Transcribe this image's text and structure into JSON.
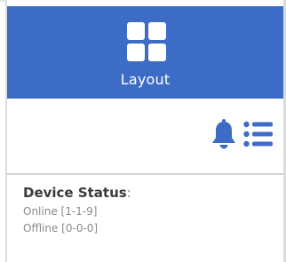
{
  "layout_tile": {
    "label": "Layout",
    "icon": "grid-layout-icon",
    "background_color": "#3d6cc6"
  },
  "toolbar": {
    "notifications_icon": "bell-icon",
    "list_icon": "list-icon",
    "icon_color": "#3d6cc6"
  },
  "device_status": {
    "heading": "Device Status",
    "separator": ":",
    "online": "Online [1-1-9]",
    "offline": "Offline [0-0-0]"
  }
}
